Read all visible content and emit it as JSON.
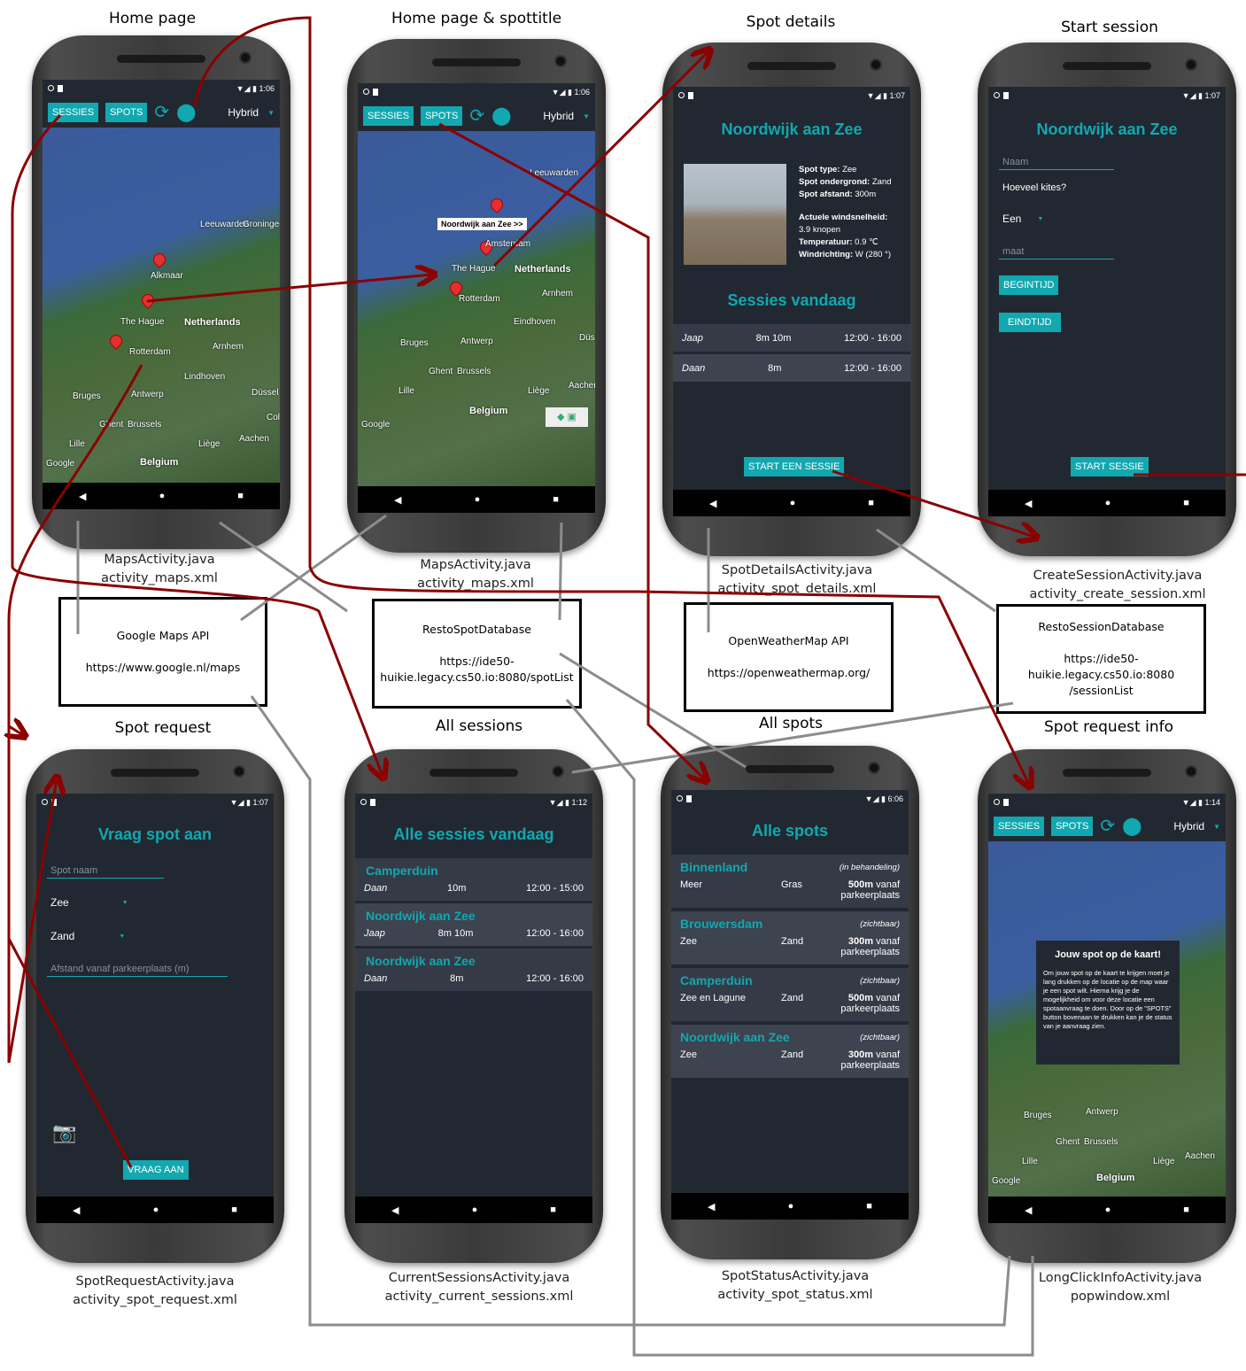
{
  "titles": {
    "home": "Home page",
    "home_spot": "Home page & spottitle",
    "details": "Spot details",
    "start": "Start session",
    "request": "Spot request",
    "all_sessions": "All sessions",
    "all_spots": "All spots",
    "request_info": "Spot request info"
  },
  "files": {
    "home": [
      "MapsActivity.java",
      "activity_maps.xml"
    ],
    "home_spot": [
      "MapsActivity.java",
      "activity_maps.xml"
    ],
    "details": [
      "SpotDetailsActivity.java",
      "activity_spot_details.xml"
    ],
    "start": [
      "CreateSessionActivity.java",
      "activity_create_session.xml"
    ],
    "request": [
      "SpotRequestActivity.java",
      "activity_spot_request.xml"
    ],
    "all_sessions": [
      "CurrentSessionsActivity.java",
      "activity_current_sessions.xml"
    ],
    "all_spots": [
      "SpotStatusActivity.java",
      "activity_spot_status.xml"
    ],
    "request_info": [
      "LongClickInfoActivity.java",
      "popwindow.xml"
    ]
  },
  "apis": {
    "google": {
      "name": "Google Maps API",
      "url": "https://www.google.nl/maps"
    },
    "spotdb": {
      "name": "RestoSpotDatabase",
      "url1": "https://ide50-",
      "url2": "huikie.legacy.cs50.io:8080/spotList"
    },
    "weather": {
      "name": "OpenWeatherMap API",
      "url": "https://openweathermap.org/"
    },
    "sessiondb": {
      "name": "RestoSessionDatabase",
      "url1": "https://ide50-",
      "url2": "huikie.legacy.cs50.io:8080",
      "url3": "/sessionList"
    }
  },
  "toolbar": {
    "sessies": "SESSIES",
    "spots": "SPOTS",
    "map_type": "Hybrid"
  },
  "times": {
    "home": "1:06",
    "home_spot": "1:06",
    "details": "1:07",
    "start": "1:07",
    "request": "1:07",
    "all_sessions": "1:12",
    "all_spots": "6:06",
    "request_info": "1:14"
  },
  "map": {
    "alkmaar": "Alkmaar",
    "netherlands": "Netherlands",
    "the_hague": "The Hague",
    "rotterdam": "Rotterdam",
    "amsterdam": "Amsterdam",
    "belgium": "Belgium",
    "antwerp": "Antwerp",
    "brussels": "Brussels",
    "ghent": "Ghent",
    "bruges": "Bruges",
    "lille": "Lille",
    "liege": "Liège",
    "aachen": "Aachen",
    "arnhem": "Arnhem",
    "eindhoven": "Eindhoven",
    "lindhoven": "Lindhoven",
    "dusseldorf": "Düssel",
    "leeuwarden": "Leeuwarden",
    "groningen": "Groningen",
    "google": "Google",
    "coln": "Colo",
    "dusel2": "Düss",
    "spot_title": "Noordwijk aan Zee >>",
    "aachen2": "Aachen"
  },
  "details": {
    "title": "Noordwijk aan Zee",
    "info": [
      [
        "Spot type:",
        "Zee"
      ],
      [
        "Spot ondergrond:",
        "Zand"
      ],
      [
        "Spot afstand:",
        "300m"
      ]
    ],
    "weather": [
      [
        "Actuele windsnelheid:",
        ""
      ],
      [
        "",
        "3.9 knopen"
      ],
      [
        "Temperatuur:",
        "0.9 ℃"
      ],
      [
        "Windrichting:",
        "W (280 °)"
      ]
    ],
    "sessions_title": "Sessies vandaag",
    "sessions": [
      {
        "name": "Jaap",
        "size": "8m 10m",
        "time": "12:00 - 16:00"
      },
      {
        "name": "Daan",
        "size": "8m",
        "time": "12:00 - 16:00"
      }
    ],
    "button": "START EEN SESSIE"
  },
  "create": {
    "title": "Noordwijk aan Zee",
    "name_ph": "Naam",
    "kites_q": "Hoeveel kites?",
    "kites_val": "Een",
    "size_ph": "maat",
    "begin": "Begintijd",
    "end": "Eindtijd",
    "button": "START SESSIE"
  },
  "request": {
    "title": "Vraag spot aan",
    "name_ph": "Spot naam",
    "type": "Zee",
    "ground": "Zand",
    "dist_ph": "Afstand vanaf parkeerplaats (m)",
    "button": "VRAAG AAN"
  },
  "sessions": {
    "title": "Alle sessies vandaag",
    "items": [
      {
        "spot": "Camperduin",
        "name": "Daan",
        "size": "10m",
        "time": "12:00 - 15:00"
      },
      {
        "spot": "Noordwijk aan Zee",
        "name": "Jaap",
        "size": "8m 10m",
        "time": "12:00 - 16:00"
      },
      {
        "spot": "Noordwijk aan Zee",
        "name": "Daan",
        "size": "8m",
        "time": "12:00 - 16:00"
      }
    ]
  },
  "spots": {
    "title": "Alle spots",
    "items": [
      {
        "name": "Binnenland",
        "status": "(in behandeling)",
        "type": "Meer",
        "ground": "Gras",
        "dist": "500m",
        "dist_suffix": " vanaf",
        "lot": "parkeerplaats"
      },
      {
        "name": "Brouwersdam",
        "status": "(zichtbaar)",
        "type": "Zee",
        "ground": "Zand",
        "dist": "300m",
        "dist_suffix": " vanaf",
        "lot": "parkeerplaats"
      },
      {
        "name": "Camperduin",
        "status": "(zichtbaar)",
        "type": "Zee en Lagune",
        "ground": "Zand",
        "dist": "500m",
        "dist_suffix": " vanaf",
        "lot": "parkeerplaats"
      },
      {
        "name": "Noordwijk aan Zee",
        "status": "(zichtbaar)",
        "type": "Zee",
        "ground": "Zand",
        "dist": "300m",
        "dist_suffix": " vanaf",
        "lot": "parkeerplaats"
      }
    ]
  },
  "popup": {
    "title": "Jouw spot op de kaart!",
    "text": "Om jouw spot op de kaart te krijgen moet je lang drukken op de locatie op de map waar je een spot wilt. Hierna krijg je de mogelijkheid om voor deze locatie een spotaanvraag te doen. Door op de \"SPOTS\" button bovenaan te drukken kan je de status van je aanvraag zien."
  },
  "colors": {
    "accent": "#11a8b0",
    "bg": "#222831",
    "arrow_red": "#8b0000",
    "line_gray": "#8c8c8c"
  }
}
